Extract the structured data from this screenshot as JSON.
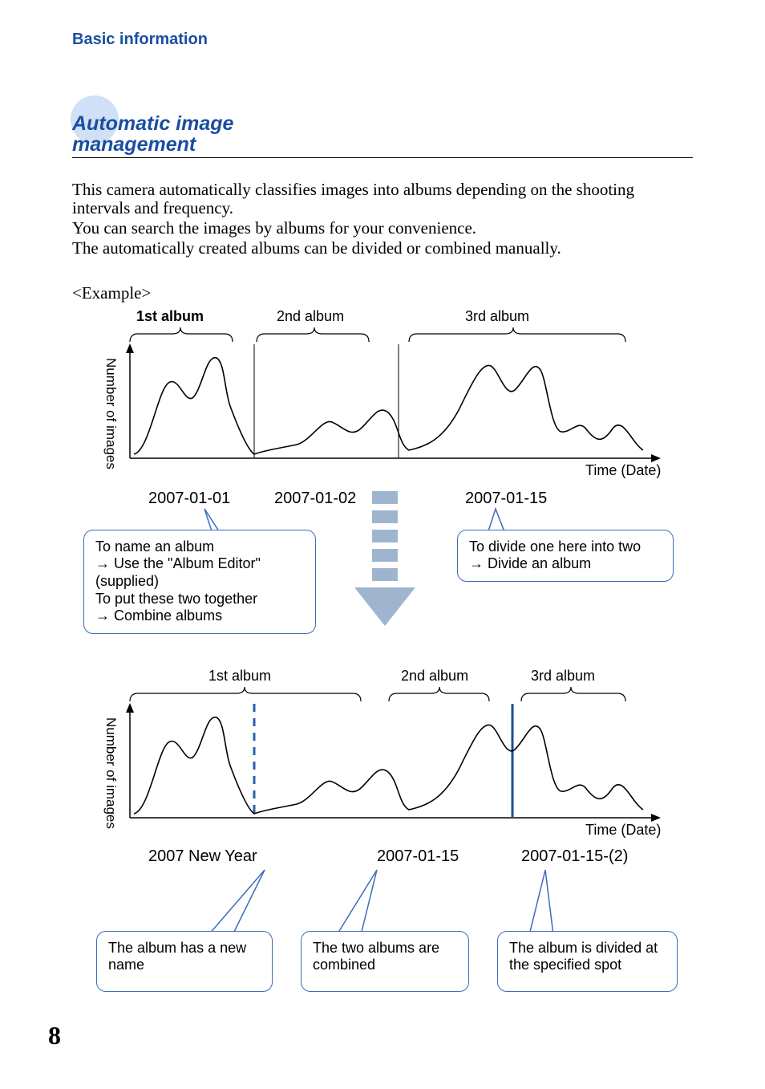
{
  "header": {
    "title": "Basic information"
  },
  "section": {
    "title_line1": "Automatic image",
    "title_line2": "management"
  },
  "body": {
    "p1": "This camera automatically classifies images into albums depending on the shooting intervals and frequency.",
    "p2": "You can search the images by albums for your convenience.",
    "p3": "The automatically created albums can be divided or combined manually."
  },
  "example_label": "<Example>",
  "chart_data": [
    {
      "type": "line",
      "title": "",
      "ylabel": "Number of images",
      "xlabel": "Time (Date)",
      "x_range": [
        0,
        100
      ],
      "y_range": [
        0,
        100
      ],
      "albums": [
        {
          "label": "1st album",
          "range": [
            5,
            26
          ],
          "date": "2007-01-01"
        },
        {
          "label": "2nd album",
          "range": [
            30,
            55
          ],
          "date": "2007-01-02"
        },
        {
          "label": "3rd album",
          "range": [
            58,
            100
          ],
          "date": "2007-01-15"
        }
      ],
      "series": [
        {
          "name": "images",
          "points": [
            [
              5,
              5
            ],
            [
              10,
              55
            ],
            [
              13,
              40
            ],
            [
              16,
              85
            ],
            [
              18,
              60
            ],
            [
              22,
              25
            ],
            [
              26,
              8
            ],
            [
              30,
              5
            ],
            [
              34,
              10
            ],
            [
              38,
              12
            ],
            [
              42,
              35
            ],
            [
              46,
              20
            ],
            [
              50,
              45
            ],
            [
              54,
              15
            ],
            [
              58,
              8
            ],
            [
              62,
              18
            ],
            [
              66,
              75
            ],
            [
              70,
              50
            ],
            [
              73,
              80
            ],
            [
              76,
              25
            ],
            [
              80,
              30
            ],
            [
              83,
              12
            ],
            [
              88,
              25
            ],
            [
              92,
              10
            ],
            [
              100,
              5
            ]
          ]
        }
      ]
    },
    {
      "type": "line",
      "title": "",
      "ylabel": "Number of images",
      "xlabel": "Time (Date)",
      "x_range": [
        0,
        100
      ],
      "y_range": [
        0,
        100
      ],
      "albums": [
        {
          "label": "1st album",
          "range": [
            5,
            55
          ],
          "date": "2007 New Year"
        },
        {
          "label": "2nd album",
          "range": [
            58,
            75
          ],
          "date": "2007-01-15"
        },
        {
          "label": "3rd album",
          "range": [
            77,
            100
          ],
          "date": "2007-01-15-(2)"
        }
      ],
      "dividers": [
        26,
        75
      ],
      "series": [
        {
          "name": "images",
          "points": [
            [
              5,
              5
            ],
            [
              10,
              55
            ],
            [
              13,
              40
            ],
            [
              16,
              85
            ],
            [
              18,
              60
            ],
            [
              22,
              25
            ],
            [
              26,
              8
            ],
            [
              30,
              5
            ],
            [
              34,
              10
            ],
            [
              38,
              12
            ],
            [
              42,
              35
            ],
            [
              46,
              20
            ],
            [
              50,
              45
            ],
            [
              54,
              15
            ],
            [
              58,
              8
            ],
            [
              62,
              18
            ],
            [
              66,
              75
            ],
            [
              70,
              50
            ],
            [
              73,
              80
            ],
            [
              76,
              25
            ],
            [
              80,
              30
            ],
            [
              83,
              12
            ],
            [
              88,
              25
            ],
            [
              92,
              10
            ],
            [
              100,
              5
            ]
          ]
        }
      ]
    }
  ],
  "callouts": {
    "c1_l1": "To name an album",
    "c1_l2": "Use the \"Album Editor\" (supplied)",
    "c1_l3": "To put these two together",
    "c1_l4": "Combine albums",
    "c2_l1": "To divide one here into two",
    "c2_l2": "Divide an album",
    "c3": "The album has a new name",
    "c4": "The two albums are combined",
    "c5": "The album is divided at the specified spot"
  },
  "arrow": "→",
  "page": "8"
}
